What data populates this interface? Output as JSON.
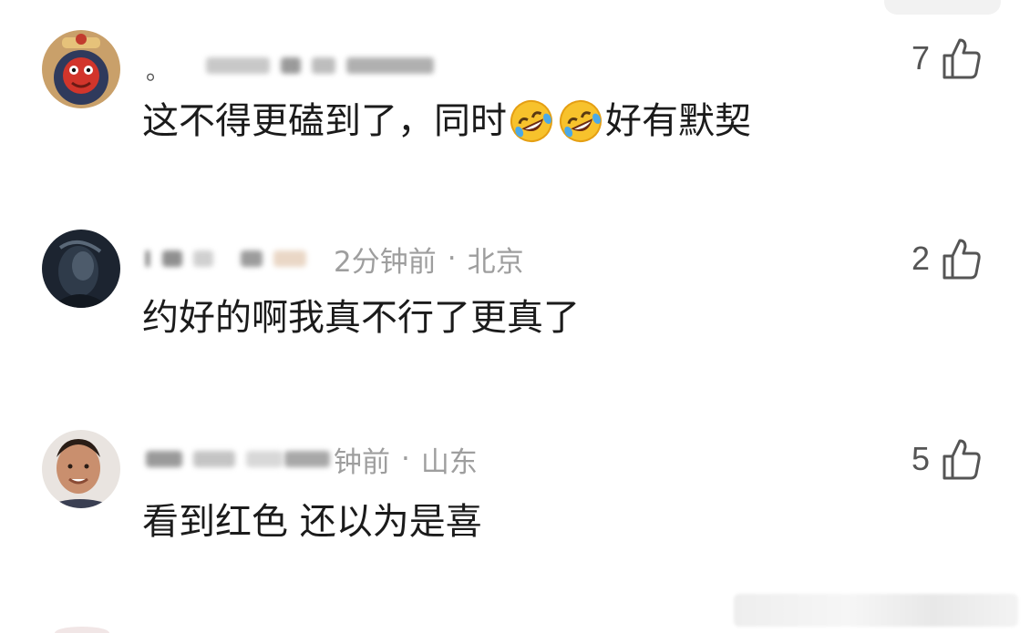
{
  "comments": [
    {
      "meta_lead": "。",
      "time": "",
      "location": "",
      "separator": "",
      "body_before": "这不得更磕到了，同时",
      "body_after": "好有默契",
      "likes": "7"
    },
    {
      "meta_lead": "",
      "time": "2分钟前",
      "location": "北京",
      "separator": "·",
      "body": "约好的啊我真不行了更真了",
      "likes": "2"
    },
    {
      "meta_lead": "",
      "time": "钟前",
      "location": "山东",
      "separator": "·",
      "body": "看到红色 还以为是喜",
      "likes": "5"
    }
  ],
  "icons": {
    "like": "thumbs-up-icon",
    "emoji": "rolling-on-floor-laughing-emoji"
  }
}
